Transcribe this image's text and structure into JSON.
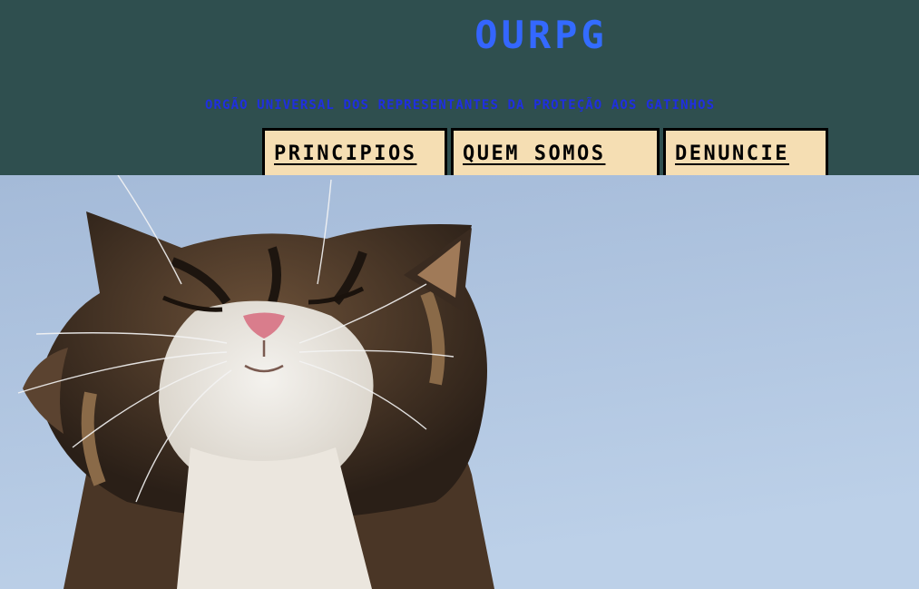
{
  "header": {
    "title": "OURPG",
    "subtitle": "ORGÃO UNIVERSAL DOS REPRESENTANTES DA PROTEÇÃO AOS GATINHOS",
    "background_color": "#2f4f4f",
    "title_gradient": [
      "#3a45ff",
      "#2d8cff"
    ],
    "subtitle_color": "#1f2fe0"
  },
  "nav": {
    "items": [
      {
        "label": "PRINCIPIOS"
      },
      {
        "label": "QUEM SOMOS"
      },
      {
        "label": "DENUNCIE"
      }
    ],
    "button_color": "#f5deb3",
    "border_color": "#000000"
  },
  "hero": {
    "image": "cat-photo",
    "sky_colors": [
      "#9fb6d6",
      "#b9cde6"
    ]
  }
}
